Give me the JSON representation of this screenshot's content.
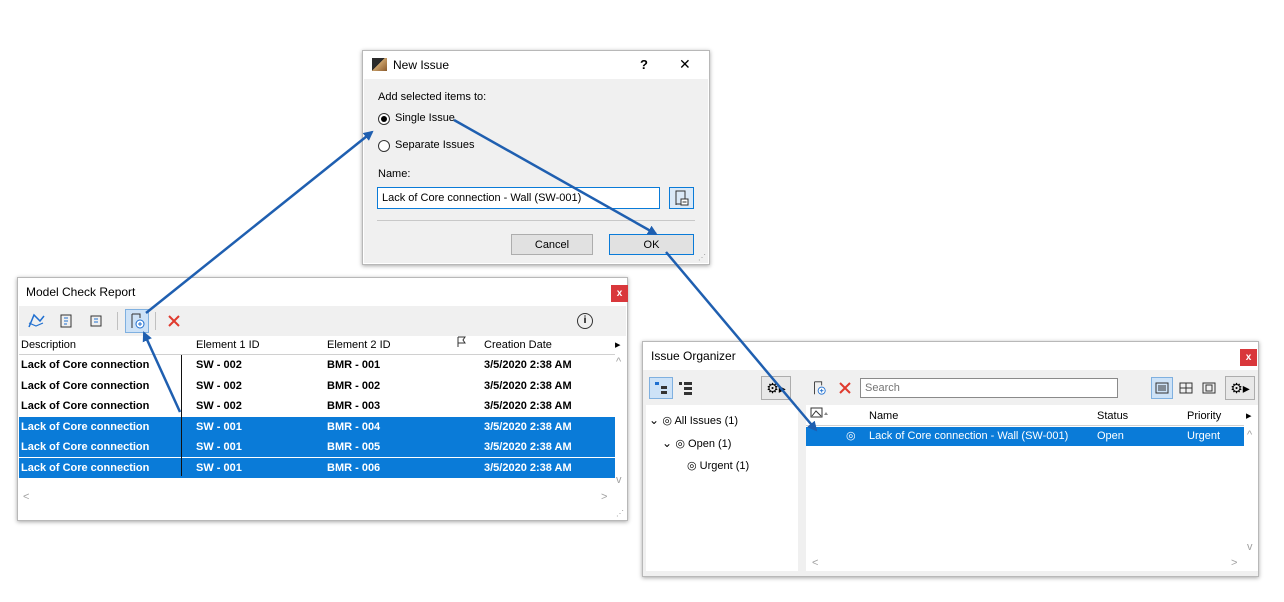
{
  "new_issue": {
    "title": "New Issue",
    "help": "?",
    "close": "✕",
    "add_label": "Add selected items to:",
    "option_single": "Single Issue",
    "option_separate": "Separate Issues",
    "name_label": "Name:",
    "name_value": "Lack of Core connection - Wall (SW-001)",
    "cancel": "Cancel",
    "ok": "OK"
  },
  "model_check": {
    "title": "Model Check Report",
    "close": "x",
    "info": "i",
    "columns": [
      "Description",
      "Element 1 ID",
      "Element 2 ID",
      "",
      "Creation Date"
    ],
    "rows": [
      {
        "desc": "Lack of Core connection",
        "e1": "SW - 002",
        "e2": "BMR - 001",
        "date": "3/5/2020 2:38 AM",
        "selected": false
      },
      {
        "desc": "Lack of Core connection",
        "e1": "SW - 002",
        "e2": "BMR - 002",
        "date": "3/5/2020 2:38 AM",
        "selected": false
      },
      {
        "desc": "Lack of Core connection",
        "e1": "SW - 002",
        "e2": "BMR - 003",
        "date": "3/5/2020 2:38 AM",
        "selected": false
      },
      {
        "desc": "Lack of Core connection",
        "e1": "SW - 001",
        "e2": "BMR - 004",
        "date": "3/5/2020 2:38 AM",
        "selected": true
      },
      {
        "desc": "Lack of Core connection",
        "e1": "SW - 001",
        "e2": "BMR - 005",
        "date": "3/5/2020 2:38 AM",
        "selected": true
      },
      {
        "desc": "Lack of Core connection",
        "e1": "SW - 001",
        "e2": "BMR - 006",
        "date": "3/5/2020 2:38 AM",
        "selected": true
      }
    ]
  },
  "issue_organizer": {
    "title": "Issue Organizer",
    "close": "x",
    "search_placeholder": "Search",
    "tree": [
      {
        "label": "All Issues (1)",
        "level": 0
      },
      {
        "label": "Open (1)",
        "level": 1
      },
      {
        "label": "Urgent (1)",
        "level": 2
      }
    ],
    "columns": [
      "Name",
      "Status",
      "Priority"
    ],
    "issues": [
      {
        "name": "Lack of Core connection - Wall (SW-001)",
        "status": "Open",
        "priority": "Urgent"
      }
    ]
  },
  "colors": {
    "selection": "#0a7bd8",
    "arrow": "#1f5fb0",
    "close": "#d9373b"
  }
}
